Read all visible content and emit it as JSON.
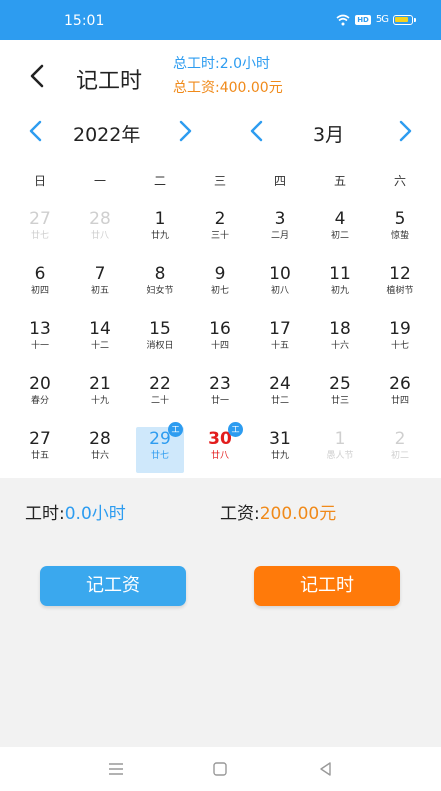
{
  "status": {
    "time": "15:01",
    "hd": "HD",
    "signal": "5G"
  },
  "header": {
    "title": "记工时",
    "total_hours_label": "总工时:",
    "total_hours_value": "2.0小时",
    "total_wage_label": "总工资:",
    "total_wage_value": "400.00元"
  },
  "nav": {
    "year": "2022年",
    "month": "3月"
  },
  "weekdays": [
    "日",
    "一",
    "二",
    "三",
    "四",
    "五",
    "六"
  ],
  "days": [
    {
      "n": "27",
      "l": "廿七",
      "dim": true
    },
    {
      "n": "28",
      "l": "廿八",
      "dim": true
    },
    {
      "n": "1",
      "l": "廿九"
    },
    {
      "n": "2",
      "l": "三十"
    },
    {
      "n": "3",
      "l": "二月"
    },
    {
      "n": "4",
      "l": "初二"
    },
    {
      "n": "5",
      "l": "惊蛰"
    },
    {
      "n": "6",
      "l": "初四"
    },
    {
      "n": "7",
      "l": "初五"
    },
    {
      "n": "8",
      "l": "妇女节"
    },
    {
      "n": "9",
      "l": "初七"
    },
    {
      "n": "10",
      "l": "初八"
    },
    {
      "n": "11",
      "l": "初九"
    },
    {
      "n": "12",
      "l": "植树节"
    },
    {
      "n": "13",
      "l": "十一"
    },
    {
      "n": "14",
      "l": "十二"
    },
    {
      "n": "15",
      "l": "消权日"
    },
    {
      "n": "16",
      "l": "十四"
    },
    {
      "n": "17",
      "l": "十五"
    },
    {
      "n": "18",
      "l": "十六"
    },
    {
      "n": "19",
      "l": "十七"
    },
    {
      "n": "20",
      "l": "春分"
    },
    {
      "n": "21",
      "l": "十九"
    },
    {
      "n": "22",
      "l": "二十"
    },
    {
      "n": "23",
      "l": "廿一"
    },
    {
      "n": "24",
      "l": "廿二"
    },
    {
      "n": "25",
      "l": "廿三"
    },
    {
      "n": "26",
      "l": "廿四"
    },
    {
      "n": "27",
      "l": "廿五"
    },
    {
      "n": "28",
      "l": "廿六"
    },
    {
      "n": "29",
      "l": "廿七",
      "selected": true,
      "badge": "工"
    },
    {
      "n": "30",
      "l": "廿八",
      "today": true,
      "badge": "工"
    },
    {
      "n": "31",
      "l": "廿九"
    },
    {
      "n": "1",
      "l": "愚人节",
      "dim": true
    },
    {
      "n": "2",
      "l": "初二",
      "dim": true
    }
  ],
  "summary": {
    "hours_label": "工时:",
    "hours_value": "0.0小时",
    "wage_label": "工资:",
    "wage_value": "200.00元"
  },
  "buttons": {
    "record_wage": "记工资",
    "record_hours": "记工时"
  },
  "colors": {
    "accent": "#2d9cf0",
    "orange": "#f08a1a",
    "today": "#e21d1d",
    "selected_bg": "#cfe8fb"
  },
  "icons": [
    "back-icon",
    "prev-year-icon",
    "next-year-icon",
    "prev-month-icon",
    "next-month-icon",
    "menu-icon",
    "home-icon",
    "back-nav-icon"
  ]
}
